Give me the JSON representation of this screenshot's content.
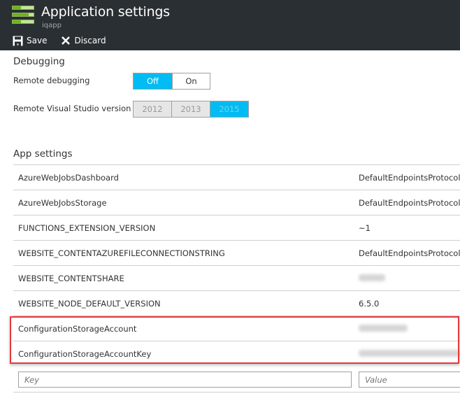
{
  "header": {
    "title": "Application settings",
    "subtitle": "iqapp",
    "icon": "app-settings-icon",
    "commands": [
      {
        "label": "Save",
        "icon": "save-icon"
      },
      {
        "label": "Discard",
        "icon": "close-icon"
      }
    ]
  },
  "debugging": {
    "title": "Debugging",
    "remote_debugging": {
      "label": "Remote debugging",
      "options": [
        "Off",
        "On"
      ],
      "selected": "Off"
    },
    "vs_version": {
      "label": "Remote Visual Studio version",
      "options": [
        "2012",
        "2013",
        "2015"
      ],
      "selected": "2015",
      "disabled": true
    }
  },
  "app_settings": {
    "title": "App settings",
    "rows": [
      {
        "key": "AzureWebJobsDashboard",
        "value": "DefaultEndpointsProtocol=",
        "redacted": false
      },
      {
        "key": "AzureWebJobsStorage",
        "value": "DefaultEndpointsProtocol=",
        "redacted": false
      },
      {
        "key": "FUNCTIONS_EXTENSION_VERSION",
        "value": "~1",
        "redacted": false
      },
      {
        "key": "WEBSITE_CONTENTAZUREFILECONNECTIONSTRING",
        "value": "DefaultEndpointsProtocol=",
        "redacted": false
      },
      {
        "key": "WEBSITE_CONTENTSHARE",
        "value": "",
        "redacted": true
      },
      {
        "key": "WEBSITE_NODE_DEFAULT_VERSION",
        "value": "6.5.0",
        "redacted": false
      },
      {
        "key": "ConfigurationStorageAccount",
        "value": "",
        "redacted": true
      },
      {
        "key": "ConfigurationStorageAccountKey",
        "value": "",
        "redacted": true
      }
    ],
    "new_key_placeholder": "Key",
    "new_value_placeholder": "Value"
  },
  "colors": {
    "header_bg": "#2a2f33",
    "accent": "#00bcf2",
    "highlight": "#e8383d"
  }
}
